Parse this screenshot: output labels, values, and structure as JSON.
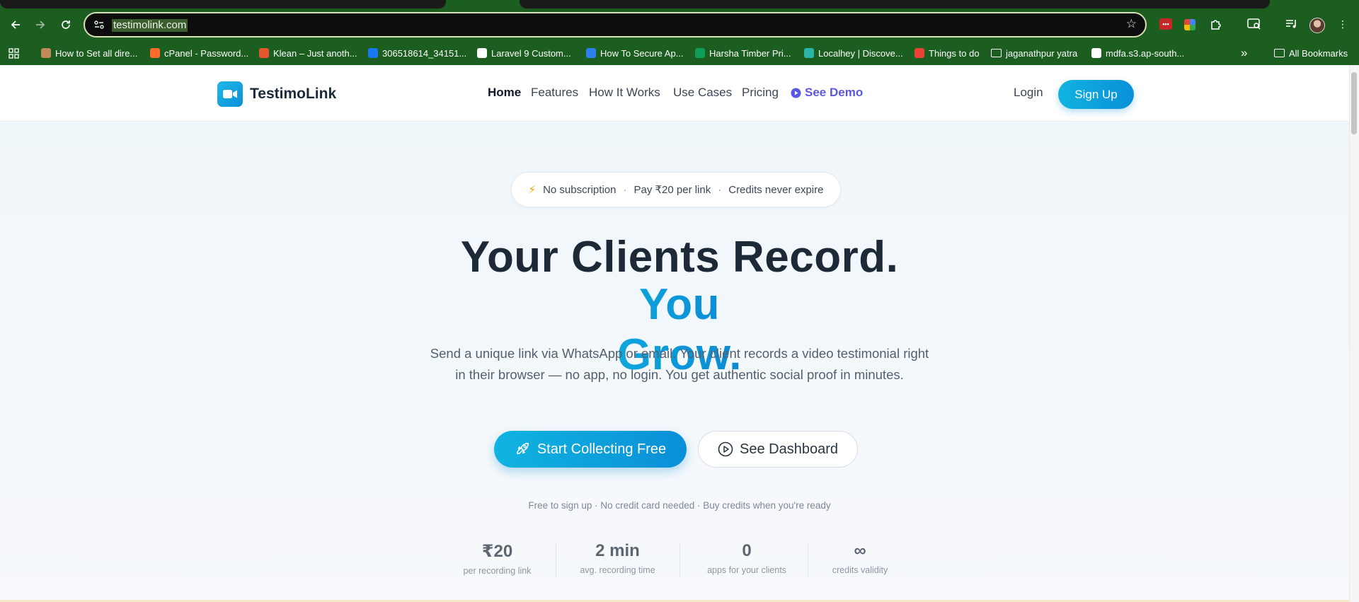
{
  "browser": {
    "url": "testimolink.com",
    "bookmarks": [
      {
        "label": "How to Set all dire...",
        "color": "#c08a5a"
      },
      {
        "label": "cPanel - Password...",
        "color": "#ff6c2c"
      },
      {
        "label": "Klean – Just anoth...",
        "color": "#e4572e"
      },
      {
        "label": "306518614_34151...",
        "color": "#1877f2"
      },
      {
        "label": "Laravel 9 Custom...",
        "color": "#ffffff"
      },
      {
        "label": "How To Secure Ap...",
        "color": "#2f80ed"
      },
      {
        "label": "Harsha Timber Pri...",
        "color": "#0f9d58"
      },
      {
        "label": "Localhey | Discove...",
        "color": "#2bb5a6"
      },
      {
        "label": "Things to do",
        "color": "#ea4335"
      },
      {
        "label": "jaganathpur yatra",
        "color": "folder"
      },
      {
        "label": "mdfa.s3.ap-south...",
        "color": "#ffffff"
      }
    ],
    "all_bookmarks": "All Bookmarks",
    "overflow": "»"
  },
  "header": {
    "brand": "TestimoLink",
    "nav": [
      "Home",
      "Features",
      "How It Works",
      "Use Cases",
      "Pricing"
    ],
    "demo": "See Demo",
    "login": "Login",
    "signup": "Sign Up"
  },
  "hero": {
    "pill": [
      "No subscription",
      "Pay ₹20 per link",
      "Credits never expire"
    ],
    "pill_sep": "·",
    "title_line1": "Your Clients Record.",
    "title_line2": "You Grow.",
    "subtext": "Send a unique link via WhatsApp or email. Your client records a video testimonial right in their browser — no app, no login. You get authentic social proof in minutes.",
    "cta_primary": "Start Collecting Free",
    "cta_secondary": "See Dashboard",
    "fineprint": "Free to sign up  ·  No credit card needed  ·  Buy credits when you're ready"
  },
  "stats": [
    {
      "value": "₹20",
      "label": "per recording link"
    },
    {
      "value": "2 min",
      "label": "avg. recording time"
    },
    {
      "value": "0",
      "label": "apps for your clients"
    },
    {
      "value": "∞",
      "label": "credits validity"
    }
  ],
  "colors": {
    "chrome_bg": "#1b5e20",
    "brand_primary": "#0a8fd8",
    "demo_link": "#5b58e0",
    "heading": "#1e2937"
  }
}
